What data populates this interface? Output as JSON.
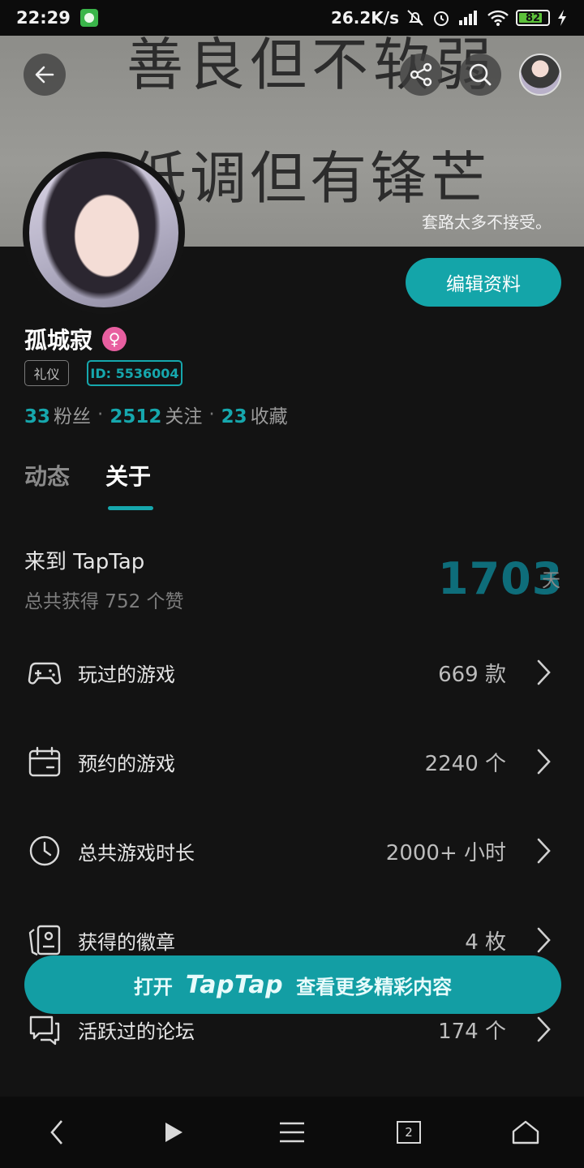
{
  "status_bar": {
    "time": "22:29",
    "net_speed": "26.2K/s",
    "battery": "82",
    "battery_level_percent": 82
  },
  "banner": {
    "line1": "善良但不软弱",
    "line2": "低调但有锋芒",
    "caption": "套路太多不接受。"
  },
  "profile": {
    "username": "孤城寂",
    "gender_symbol": "♀",
    "tag_etiquette": "礼仪",
    "user_id": "ID: 5536004",
    "edit_button": "编辑资料",
    "stats": [
      {
        "num": "33",
        "label": "粉丝"
      },
      {
        "num": "2512",
        "label": "关注"
      },
      {
        "num": "23",
        "label": "收藏"
      }
    ],
    "stat_separator": "·"
  },
  "tabs": [
    {
      "label": "动态",
      "active": false
    },
    {
      "label": "关于",
      "active": true
    }
  ],
  "about": {
    "come_title": "来到 TapTap",
    "likes": "总共获得 752 个赞",
    "days": "1703",
    "days_unit": "天"
  },
  "rows": [
    {
      "icon": "gamepad-icon",
      "label": "玩过的游戏",
      "value": "669 款"
    },
    {
      "icon": "calendar-icon",
      "label": "预约的游戏",
      "value": "2240 个"
    },
    {
      "icon": "clock-icon",
      "label": "总共游戏时长",
      "value": "2000+ 小时"
    },
    {
      "icon": "badge-icon",
      "label": "获得的徽章",
      "value": "4 枚"
    },
    {
      "icon": "chat-icon",
      "label": "活跃过的论坛",
      "value": "174 个"
    }
  ],
  "cta": {
    "prefix": "打开",
    "brand": "TapTap",
    "suffix": "查看更多精彩内容"
  },
  "nav": {
    "tabs_count": "2"
  },
  "colors": {
    "accent": "#16a7ad",
    "background": "#131313",
    "days_number": "#0e6d7a",
    "gender": "#e85fa0"
  }
}
